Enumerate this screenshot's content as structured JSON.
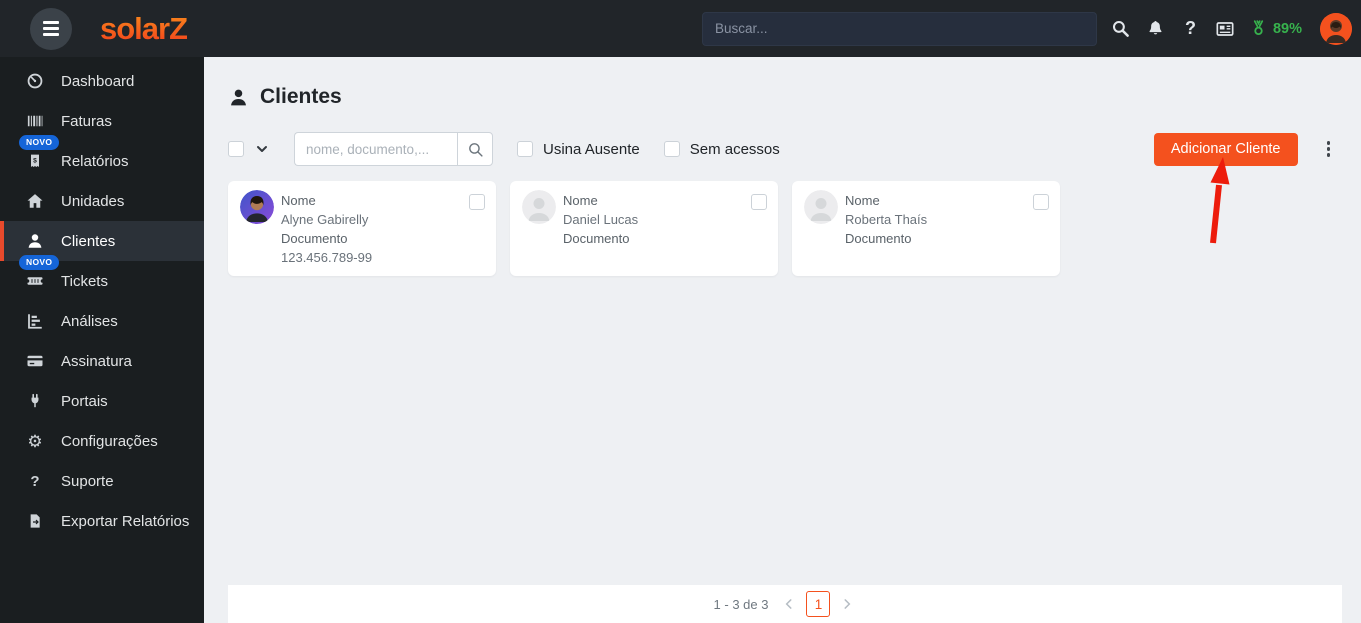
{
  "topbar": {
    "logo_text": "solarZ",
    "search_placeholder": "Buscar...",
    "health_percent": "89%"
  },
  "sidebar": {
    "items": [
      {
        "label": "Dashboard"
      },
      {
        "label": "Faturas"
      },
      {
        "label": "Relatórios",
        "badge": "NOVO"
      },
      {
        "label": "Unidades"
      },
      {
        "label": "Clientes"
      },
      {
        "label": "Tickets",
        "badge": "NOVO"
      },
      {
        "label": "Análises"
      },
      {
        "label": "Assinatura"
      },
      {
        "label": "Portais"
      },
      {
        "label": "Configurações"
      },
      {
        "label": "Suporte"
      },
      {
        "label": "Exportar Relatórios"
      }
    ]
  },
  "main": {
    "title": "Clientes",
    "filters": {
      "search_placeholder": "nome, documento,...",
      "usina_ausente_label": "Usina Ausente",
      "sem_acessos_label": "Sem acessos"
    },
    "add_button_label": "Adicionar Cliente",
    "card_labels": {
      "name": "Nome",
      "document": "Documento"
    },
    "clients": [
      {
        "name": "Alyne Gabirelly",
        "document": "123.456.789-99"
      },
      {
        "name": "Daniel Lucas",
        "document": ""
      },
      {
        "name": "Roberta Thaís",
        "document": ""
      }
    ],
    "pagination": {
      "range": "1 - 3 de 3",
      "page": "1"
    }
  },
  "colors": {
    "accent_orange": "#f4511e",
    "badge_blue": "#1565d8",
    "health_green": "#37b24d",
    "arrow_red": "#ed1c0c",
    "sidebar_bg": "#1a1e20",
    "topbar_bg": "#212529"
  }
}
